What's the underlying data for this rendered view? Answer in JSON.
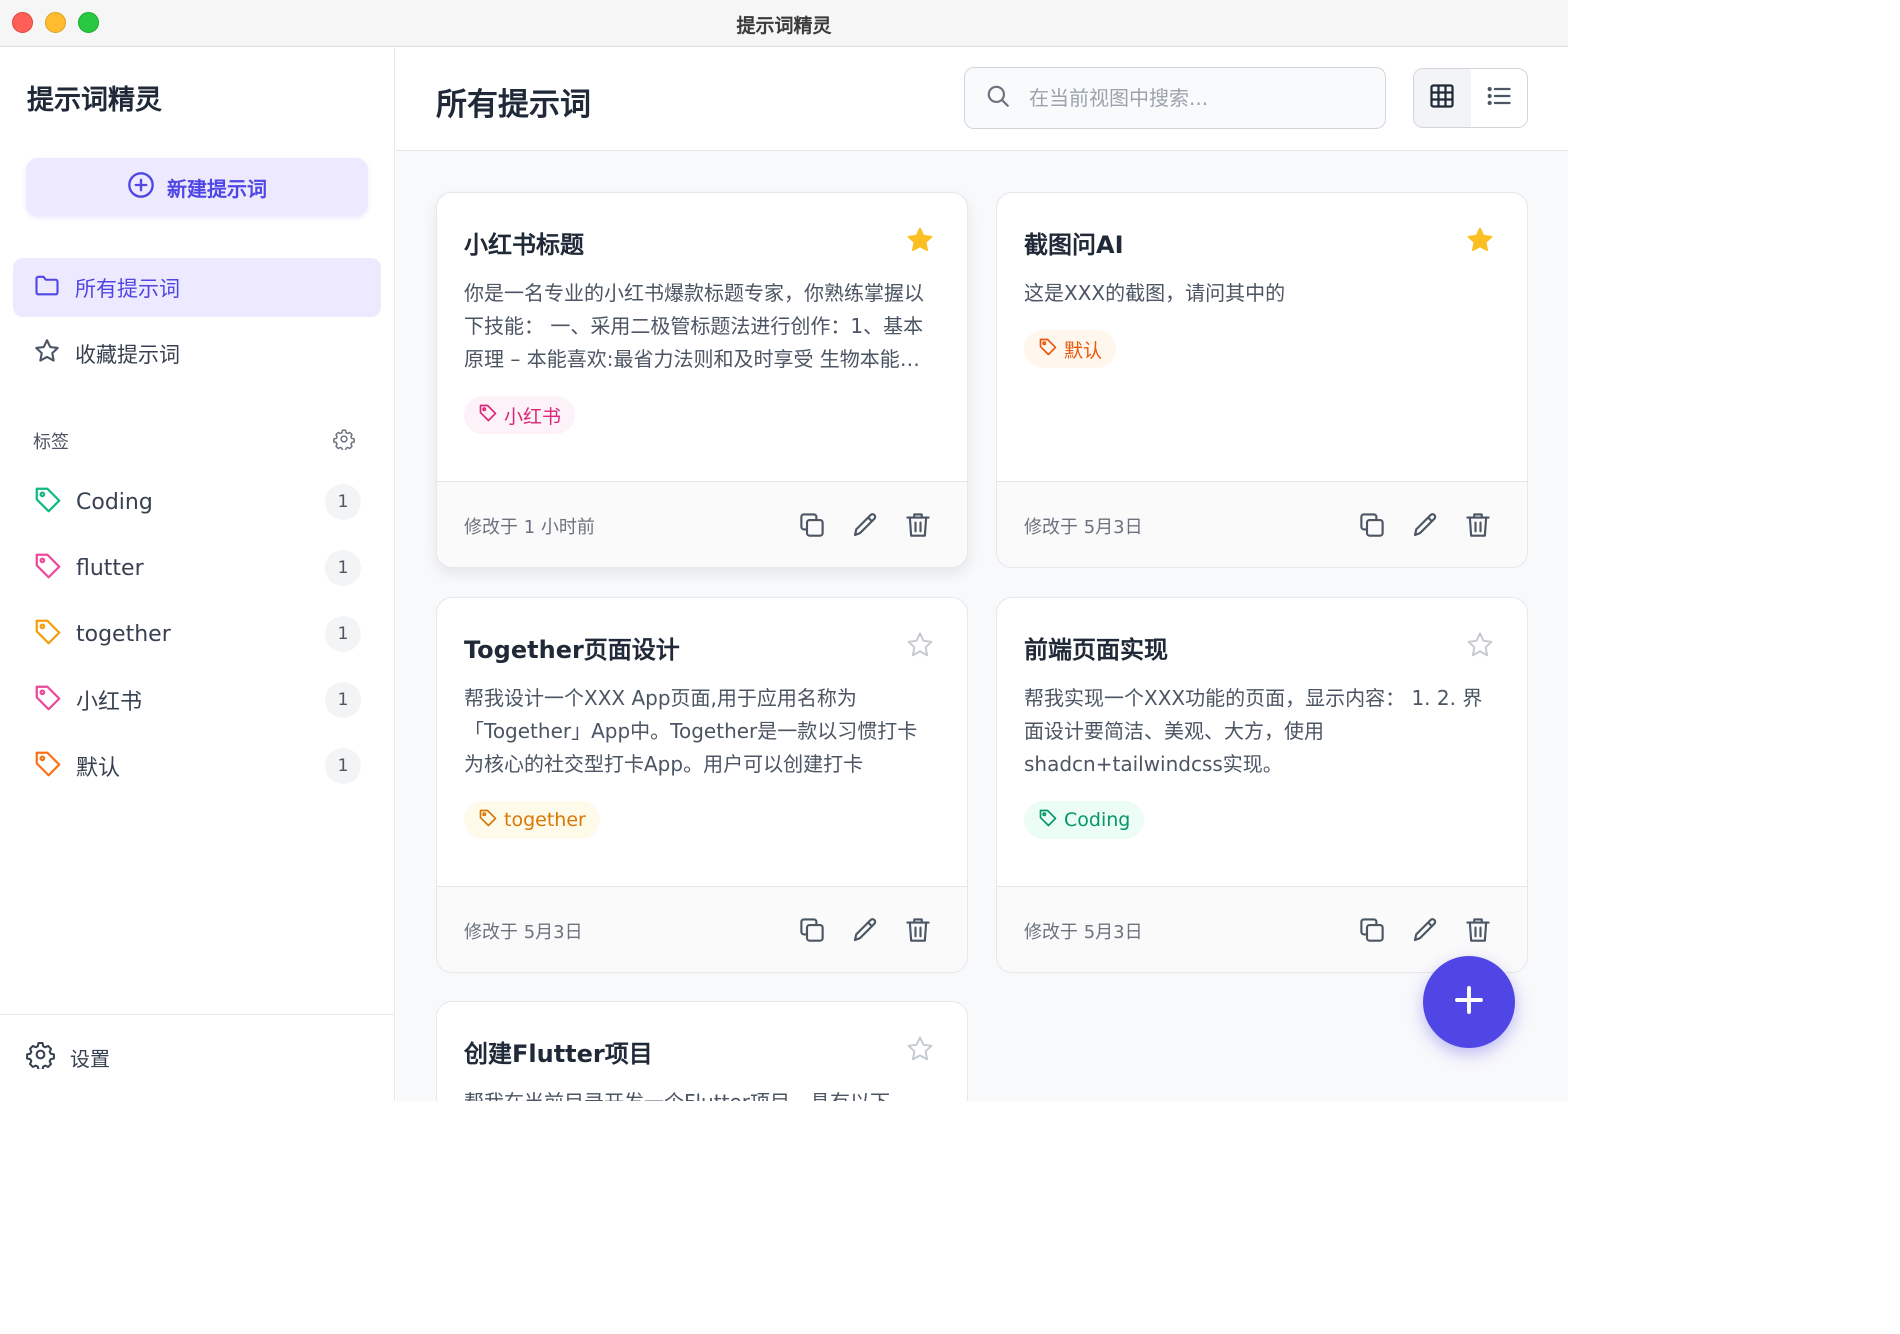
{
  "window": {
    "title": "提示词精灵"
  },
  "sidebar": {
    "app_name": "提示词精灵",
    "new_button": "新建提示词",
    "nav": [
      {
        "label": "所有提示词",
        "icon": "folder-icon",
        "active": true
      },
      {
        "label": "收藏提示词",
        "icon": "star-icon",
        "active": false
      }
    ],
    "tags_title": "标签",
    "tags": [
      {
        "name": "Coding",
        "count": "1",
        "color": "#10b981"
      },
      {
        "name": "flutter",
        "count": "1",
        "color": "#ec4899"
      },
      {
        "name": "together",
        "count": "1",
        "color": "#f59e0b"
      },
      {
        "name": "小红书",
        "count": "1",
        "color": "#ec4899"
      },
      {
        "name": "默认",
        "count": "1",
        "color": "#f97316"
      }
    ],
    "settings_label": "设置"
  },
  "main": {
    "title": "所有提示词",
    "search_placeholder": "在当前视图中搜索...",
    "view_mode": "grid",
    "cards": [
      {
        "title": "小红书标题",
        "favorite": true,
        "description": "你是一名专业的小红书爆款标题专家，你熟练掌握以下技能： 一、采用二极管标题法进行创作：1、基本原理 – 本能喜欢:最省力法则和及时享受 生物本能驱动力",
        "tag": "小红书",
        "modified": "修改于 1 小时前"
      },
      {
        "title": "截图问AI",
        "favorite": true,
        "description": "这是XXX的截图，请问其中的",
        "tag": "默认",
        "modified": "修改于 5月3日"
      },
      {
        "title": "Together页面设计",
        "favorite": false,
        "description": "帮我设计一个XXX App页面,用于应用名称为「Together」App中。Together是一款以习惯打卡为核心的社交型打卡App。用户可以创建打卡",
        "tag": "together",
        "modified": "修改于 5月3日"
      },
      {
        "title": "前端页面实现",
        "favorite": false,
        "description": "帮我实现一个XXX功能的页面，显示内容： 1. 2. 界面设计要简洁、美观、大方，使用shadcn+tailwindcss实现。",
        "tag": "Coding",
        "modified": "修改于 5月3日"
      },
      {
        "title": "创建Flutter项目",
        "favorite": false,
        "description": "帮我在当前目录开发一个Flutter项目，具有以下",
        "tag": "",
        "modified": ""
      }
    ]
  },
  "colors": {
    "accent": "#4f46e5",
    "accent_soft": "#ede9fe",
    "star_on": "#fbbf24"
  }
}
